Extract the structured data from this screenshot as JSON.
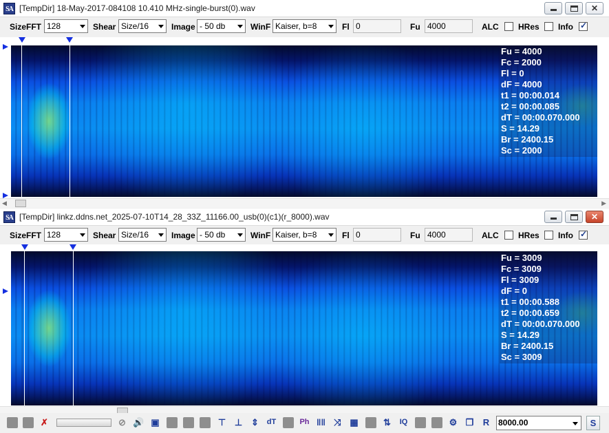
{
  "windows": [
    {
      "title": "[TempDir] 18-May-2017-084108 10.410 MHz-single-burst(0).wav",
      "toolbar": {
        "sizefft_label": "SizeFFT",
        "sizefft_value": "128",
        "shear_label": "Shear",
        "shear_value": "Size/16",
        "image_label": "Image",
        "image_value": "- 50 db",
        "winf_label": "WinF",
        "winf_value": "Kaiser, b=8",
        "fl_label": "Fl",
        "fl_value": "0",
        "fu_label": "Fu",
        "fu_value": "4000",
        "alc_label": "ALC",
        "alc_checked": false,
        "hres_label": "HRes",
        "hres_checked": false,
        "info_label": "Info",
        "info_checked": true
      },
      "info": {
        "fu": "Fu = 4000",
        "fc": "Fc = 2000",
        "fl": "Fl = 0",
        "df": "dF = 4000",
        "t1": "t1 = 00:00.014",
        "t2": "t2 = 00:00.085",
        "dt": "dT = 00:00.070.000",
        "s": "S = 14.29",
        "br": "Br = 2400.15",
        "sc": "Sc = 2000"
      }
    },
    {
      "title": "[TempDir] linkz.ddns.net_2025-07-10T14_28_33Z_11166.00_usb(0)(c1)(r_8000).wav",
      "toolbar": {
        "sizefft_label": "SizeFFT",
        "sizefft_value": "128",
        "shear_label": "Shear",
        "shear_value": "Size/16",
        "image_label": "Image",
        "image_value": "- 50 db",
        "winf_label": "WinF",
        "winf_value": "Kaiser, b=8",
        "fl_label": "Fl",
        "fl_value": "0",
        "fu_label": "Fu",
        "fu_value": "4000",
        "alc_label": "ALC",
        "alc_checked": false,
        "hres_label": "HRes",
        "hres_checked": false,
        "info_label": "Info",
        "info_checked": true
      },
      "info": {
        "fu": "Fu = 3009",
        "fc": "Fc = 3009",
        "fl": "Fl = 3009",
        "df": "dF = 0",
        "t1": "t1 = 00:00.588",
        "t2": "t2 = 00:00.659",
        "dt": "dT = 00:00.070.000",
        "s": "S = 14.29",
        "br": "Br = 2400.15",
        "sc": "Sc = 3009"
      }
    }
  ],
  "app_icon_text": "SA",
  "window_buttons": {
    "minimize": "minimize",
    "maximize": "maximize",
    "close": "✕"
  },
  "bottom": {
    "combo_value": "8000.00",
    "s_button": "S",
    "icons": [
      "gray-square-icon",
      "gray-square-icon",
      "cross-out-icon",
      "slider",
      "no-entry-icon",
      "speaker-icon",
      "square-target-icon",
      "gray-square-icon",
      "gray-square-icon",
      "gray-square-icon",
      "gray-square-icon",
      "align-top-icon",
      "align-bottom-icon",
      "align-both-icon",
      "dt-icon",
      "gray-square-icon",
      "ph-icon",
      "comb-icon",
      "cross-arrows-icon",
      "grid-icon",
      "gray-square-icon",
      "updown-arrows-icon",
      "iq-icon",
      "gray-square-icon",
      "gray-square-icon",
      "gear-icon",
      "copy-icon",
      "r-icon"
    ]
  }
}
